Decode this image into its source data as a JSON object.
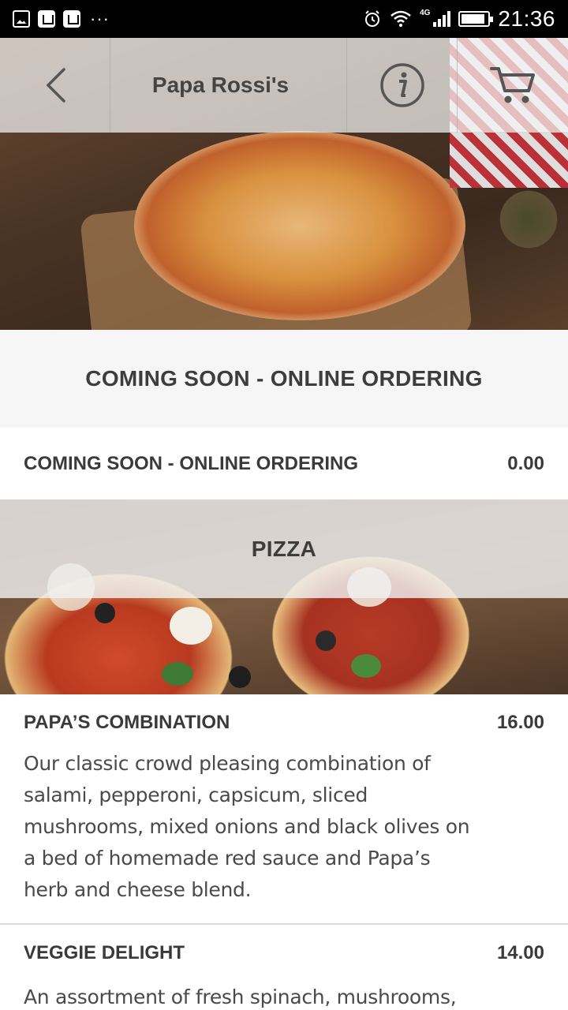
{
  "status_bar": {
    "time": "21:36",
    "network": "4G",
    "notification_icons": [
      "image-icon",
      "bag-icon",
      "bag-icon"
    ],
    "more": "···"
  },
  "header": {
    "title": "Papa Rossi's",
    "back_icon": "chevron-left-icon",
    "info_icon": "info-icon",
    "cart_icon": "cart-icon"
  },
  "sections": [
    {
      "title": "COMING SOON - ONLINE ORDERING",
      "items": [
        {
          "name": "COMING SOON - ONLINE ORDERING",
          "price": "0.00",
          "description": ""
        }
      ]
    },
    {
      "title": "PIZZA",
      "items": [
        {
          "name": "PAPA’S COMBINATION",
          "price": "16.00",
          "description": "Our classic crowd pleasing combination of salami, pepperoni, capsicum, sliced mushrooms, mixed onions and black olives on a bed of homemade red sauce and Papa’s herb and cheese blend."
        },
        {
          "name": "VEGGIE DELIGHT",
          "price": "14.00",
          "description": "An assortment of fresh spinach, mushrooms,"
        }
      ]
    }
  ],
  "colors": {
    "text_primary": "#3d3d3d",
    "section_bg": "#f6f6f6",
    "divider": "#d6d6d6"
  }
}
